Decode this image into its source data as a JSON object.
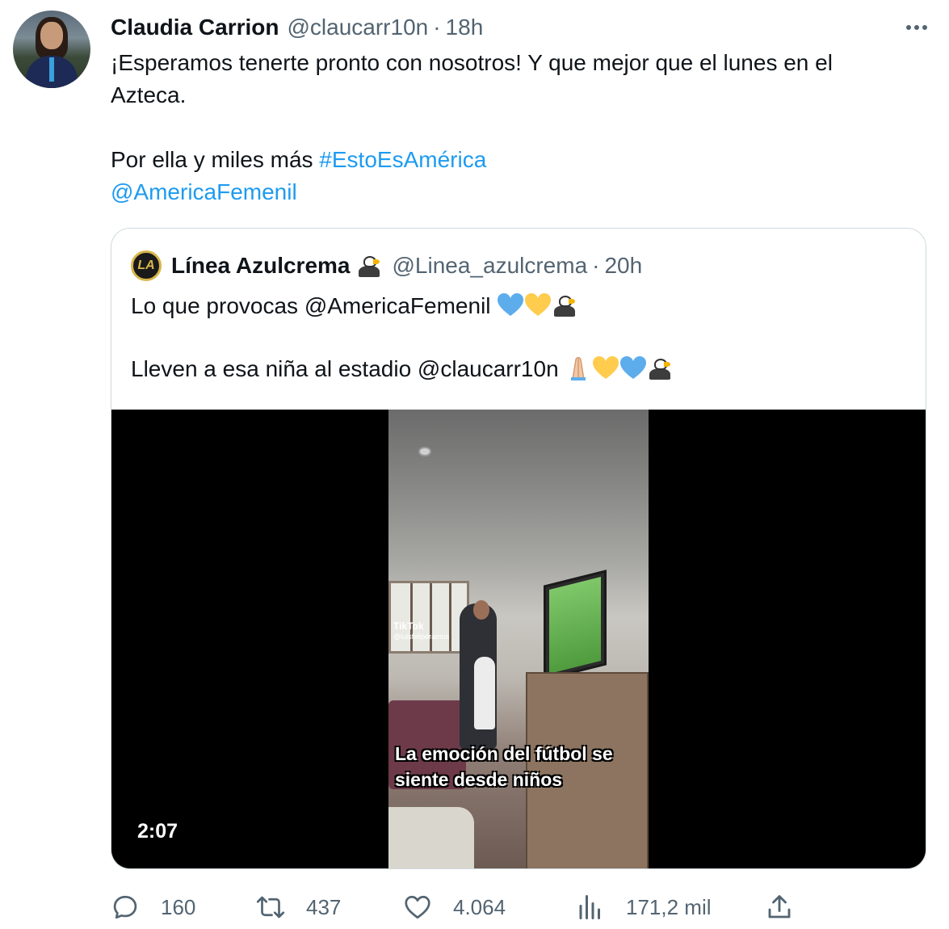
{
  "tweet": {
    "name": "Claudia Carrion",
    "handle": "@claucarr10n",
    "separator": "·",
    "time": "18h",
    "text_line1": "¡Esperamos tenerte pronto con nosotros! Y que mejor que el lunes en el",
    "text_line2": "Azteca.",
    "text_line3_prefix": "Por ella y miles más ",
    "hashtag": "#EstoEsAmérica",
    "mention": "@AmericaFemenil"
  },
  "quote": {
    "name": "Línea Azulcrema",
    "handle": "@Linea_azulcrema",
    "separator": "·",
    "time": "20h",
    "line1": "Lo que provocas @AmericaFemenil",
    "line2": "Lleven a esa niña al estadio @claucarr10n",
    "avatar_initials": "LA",
    "video": {
      "duration": "2:07",
      "tiktok_label": "TikTok",
      "tiktok_user": "@luisfeliperamos",
      "caption_line1": "La emoción del fútbol se",
      "caption_line2": "siente desde niños"
    }
  },
  "actions": {
    "replies": "160",
    "retweets": "437",
    "likes": "4.064",
    "views": "171,2 mil"
  },
  "colors": {
    "accent": "#1d9bf0",
    "secondary_text": "#536471",
    "border": "#cfd9de",
    "heart_blue": "#5dadec",
    "heart_yellow": "#ffcc4d"
  },
  "icons": [
    "more-icon",
    "eagle-emoji",
    "blue-heart-emoji",
    "yellow-heart-emoji",
    "praying-hands-emoji",
    "reply-icon",
    "retweet-icon",
    "like-icon",
    "views-icon",
    "share-icon"
  ]
}
